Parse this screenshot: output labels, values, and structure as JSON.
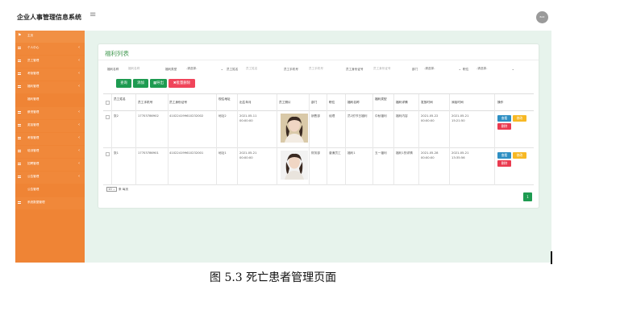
{
  "header": {
    "app_title": "企业人事管理信息系统",
    "menu_icon": "hamburger-icon",
    "avatar_text": "Bolt"
  },
  "sidebar": {
    "items": [
      {
        "label": "主页",
        "icon": "flag-icon",
        "has_arrow": false,
        "type": "home"
      },
      {
        "label": "个人中心",
        "icon": "list-icon",
        "has_arrow": true,
        "type": "top"
      },
      {
        "label": "员工管理",
        "icon": "list-icon",
        "has_arrow": true,
        "type": "top"
      },
      {
        "label": "考勤管理",
        "icon": "list-icon",
        "has_arrow": true,
        "type": "top"
      },
      {
        "label": "福利管理",
        "icon": "list-icon",
        "has_arrow": true,
        "type": "top"
      },
      {
        "label": "福利管理",
        "icon": "",
        "has_arrow": false,
        "type": "sub"
      },
      {
        "label": "薪资管理",
        "icon": "list-icon",
        "has_arrow": true,
        "type": "top"
      },
      {
        "label": "奖惩管理",
        "icon": "list-icon",
        "has_arrow": true,
        "type": "top"
      },
      {
        "label": "考核管理",
        "icon": "list-icon",
        "has_arrow": true,
        "type": "top"
      },
      {
        "label": "培训管理",
        "icon": "list-icon",
        "has_arrow": true,
        "type": "top"
      },
      {
        "label": "招聘管理",
        "icon": "list-icon",
        "has_arrow": true,
        "type": "top"
      },
      {
        "label": "公告管理",
        "icon": "list-icon",
        "has_arrow": true,
        "type": "top"
      },
      {
        "label": "公告管理",
        "icon": "",
        "has_arrow": false,
        "type": "sub"
      },
      {
        "label": "系统数据管理",
        "icon": "list-icon",
        "has_arrow": false,
        "type": "top"
      }
    ]
  },
  "panel": {
    "title": "福利列表"
  },
  "filters": {
    "name_label": "福利名称",
    "name_placeholder": "福利名称",
    "type_label": "福利类型",
    "type_value": "-请选择-",
    "emp_name_label": "员工姓名",
    "emp_name_placeholder": "员工姓名",
    "phone_label": "员工手机号",
    "phone_placeholder": "员工手机号",
    "idcard_label": "员工身份证号",
    "idcard_placeholder": "员工身份证号",
    "dept_label": "部门",
    "dept_value": "-请选择-",
    "position_label": "职位",
    "position_value": "-请选择-"
  },
  "buttons": {
    "search": "查询",
    "add": "添加",
    "export": "导出",
    "batch_delete": "批量删除"
  },
  "table": {
    "headers": [
      "员工姓名",
      "员工手机号",
      "员工身份证号",
      "现住地址",
      "出生年月",
      "员工照片",
      "部门",
      "职位",
      "福利名称",
      "福利类型",
      "福利详情",
      "发放时间",
      "添加时间",
      "操作"
    ],
    "rows": [
      {
        "name": "张2",
        "phone": "17703786902",
        "idcard": "410224199610232002",
        "address": "地址2",
        "birth": "2021-05-11\n00:00:00",
        "dept": "销售部",
        "position": "经理",
        "welfare_name": "员2的节日福利",
        "welfare_type": "中秋福利",
        "detail": "福利内容",
        "issue_time": "2021-05-22\n00:00:00",
        "add_time": "2021-05-21\n15:21:50"
      },
      {
        "name": "张1",
        "phone": "17703786901",
        "idcard": "410224199610232001",
        "address": "地址1",
        "birth": "2021-05-21\n00:00:00",
        "dept": "财务部",
        "position": "普通员工",
        "welfare_name": "福利1",
        "welfare_type": "五一福利",
        "detail": "福利1的详情",
        "issue_time": "2021-05-28\n00:00:00",
        "add_time": "2021-05-21\n13:35:56"
      }
    ],
    "actions": {
      "view": "查看",
      "edit": "修改",
      "delete": "删除"
    }
  },
  "pagination": {
    "page_size": "10",
    "suffix": "条 每页",
    "current_page": "1"
  },
  "caption": "图 5.3  死亡患者管理页面"
}
